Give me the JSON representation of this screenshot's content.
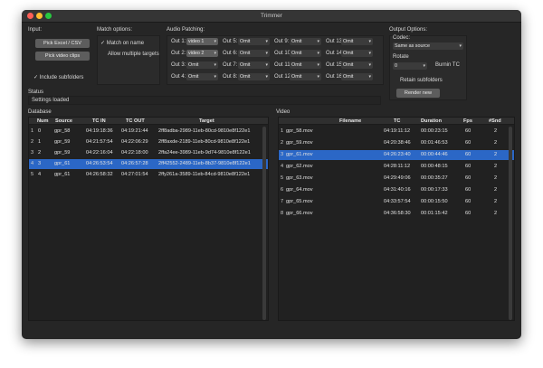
{
  "window": {
    "title": "Trimmer"
  },
  "input": {
    "label": "Input:",
    "pick_excel": "Pick Excel / CSV",
    "pick_video": "Pick video clips",
    "include_subfolders": "Include subfolders"
  },
  "match": {
    "label": "Match options:",
    "match_on_name": "Match on name",
    "allow_multiple": "Allow multiple targets"
  },
  "audio": {
    "label": "Audio Patching:",
    "outs": [
      {
        "label": "Out 1:",
        "value": "video 1"
      },
      {
        "label": "Out 5:",
        "value": "Omit"
      },
      {
        "label": "Out 9:",
        "value": "Omit"
      },
      {
        "label": "Out 13:",
        "value": "Omit"
      },
      {
        "label": "Out 2:",
        "value": "video 2"
      },
      {
        "label": "Out 6:",
        "value": "Omit"
      },
      {
        "label": "Out 10:",
        "value": "Omit"
      },
      {
        "label": "Out 14:",
        "value": "Omit"
      },
      {
        "label": "Out 3:",
        "value": "Omit"
      },
      {
        "label": "Out 7:",
        "value": "Omit"
      },
      {
        "label": "Out 11:",
        "value": "Omit"
      },
      {
        "label": "Out 15:",
        "value": "Omit"
      },
      {
        "label": "Out 4:",
        "value": "Omit"
      },
      {
        "label": "Out 8:",
        "value": "Omit"
      },
      {
        "label": "Out 12:",
        "value": "Omit"
      },
      {
        "label": "Out 16:",
        "value": "Omit"
      }
    ]
  },
  "output": {
    "label": "Output Options:",
    "codec_label": "Codec:",
    "codec_value": "Same as source",
    "rotate_label": "Rotate",
    "rotate_value": "0",
    "burnin": "Burnin TC",
    "retain": "Retain subfolders",
    "render": "Render new"
  },
  "status": {
    "label": "Status",
    "text": "Settings loaded"
  },
  "database": {
    "label": "Database",
    "columns": [
      "Num",
      "Source",
      "TC IN",
      "TC OUT",
      "Target"
    ],
    "rows": [
      {
        "rn": "1",
        "num": "0",
        "source": "gpr_58",
        "tc_in": "04:19:18:36",
        "tc_out": "04:19:21:44",
        "target": "2ff8adba-2989-11eb-80cd-9810e8f122e1"
      },
      {
        "rn": "2",
        "num": "1",
        "source": "gpr_59",
        "tc_in": "04:21:57:54",
        "tc_out": "04:22:06:29",
        "target": "2ff8axde-2189-11eb-80cd-9810e8f122e1"
      },
      {
        "rn": "3",
        "num": "2",
        "source": "gpr_59",
        "tc_in": "04:22:16:04",
        "tc_out": "04:22:18:00",
        "target": "2ffa24ee-3989-11eb-9d74-9810e8f122e1"
      },
      {
        "rn": "4",
        "num": "3",
        "source": "gpr_61",
        "tc_in": "04:26:53:54",
        "tc_out": "04:26:57:28",
        "target": "2ff42552-2489-11eb-8b37-9810e8f122e1"
      },
      {
        "rn": "5",
        "num": "4",
        "source": "gpr_61",
        "tc_in": "04:26:58:32",
        "tc_out": "04:27:01:54",
        "target": "2ffy261a-3589-11eb-84cd-9810e8f122e1"
      }
    ]
  },
  "video": {
    "label": "Video",
    "columns": [
      "Filename",
      "TC",
      "Duration",
      "Fps",
      "#Snd"
    ],
    "rows": [
      {
        "rn": "1",
        "filename": "gpr_58.mov",
        "tc": "04:19:11:12",
        "duration": "00:00:23:15",
        "fps": "60",
        "snd": "2"
      },
      {
        "rn": "2",
        "filename": "gpr_59.mov",
        "tc": "04:20:38:46",
        "duration": "00:01:46:53",
        "fps": "60",
        "snd": "2"
      },
      {
        "rn": "3",
        "filename": "gpr_61.mov",
        "tc": "04:26:23:40",
        "duration": "00:00:44:46",
        "fps": "60",
        "snd": "2"
      },
      {
        "rn": "4",
        "filename": "gpr_62.mov",
        "tc": "04:28:11:12",
        "duration": "00:00:48:15",
        "fps": "60",
        "snd": "2"
      },
      {
        "rn": "5",
        "filename": "gpr_63.mov",
        "tc": "04:29:49:06",
        "duration": "00:00:35:27",
        "fps": "60",
        "snd": "2"
      },
      {
        "rn": "6",
        "filename": "gpr_64.mov",
        "tc": "04:31:40:16",
        "duration": "00:00:17:33",
        "fps": "60",
        "snd": "2"
      },
      {
        "rn": "7",
        "filename": "gpr_65.mov",
        "tc": "04:33:57:54",
        "duration": "00:00:15:50",
        "fps": "60",
        "snd": "2"
      },
      {
        "rn": "8",
        "filename": "gpr_66.mov",
        "tc": "04:36:58:30",
        "duration": "00:01:15:42",
        "fps": "60",
        "snd": "2"
      }
    ]
  },
  "colors": {
    "selection": "#2b67c6",
    "background": "#262626"
  }
}
